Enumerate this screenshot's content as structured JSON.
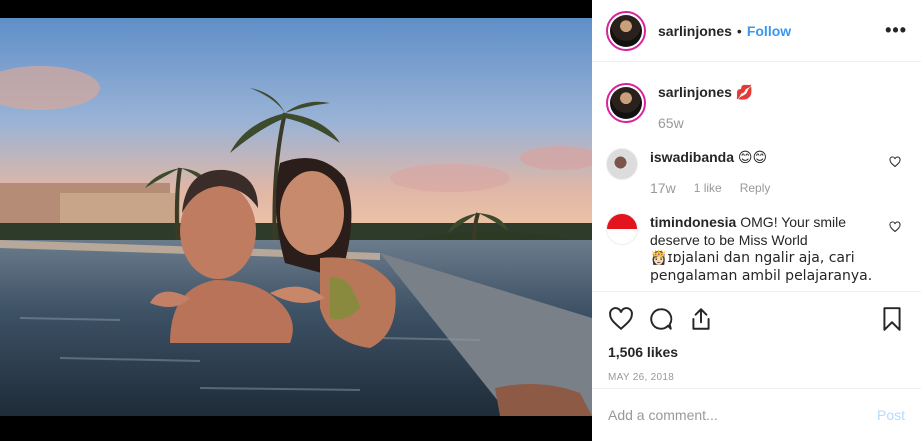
{
  "post": {
    "username": "sarlinjones",
    "separator": "•",
    "follow_label": "Follow",
    "more_label": "•••",
    "caption_emoji": "💋",
    "caption_time": "65w",
    "comments": [
      {
        "username": "iswadibanda",
        "text": "😊😊",
        "time": "17w",
        "likes": "1 like",
        "reply": "Reply"
      },
      {
        "username": "timindonesia",
        "text": "OMG! Your smile deserve to be Miss World",
        "extra": "👸🏻ɪɒjalani dan ngalir aja, cari pengalaman ambil pelajaranya."
      }
    ],
    "likes_count": "1,506 likes",
    "date": "MAY 26, 2018",
    "add_comment_placeholder": "Add a comment...",
    "post_label": "Post"
  },
  "icons": [
    "heart-icon",
    "comment-icon",
    "share-icon",
    "bookmark-icon",
    "more-icon"
  ],
  "colors": {
    "accent": "#3897f0",
    "muted": "#999999",
    "post_disabled": "#b3dbff"
  }
}
